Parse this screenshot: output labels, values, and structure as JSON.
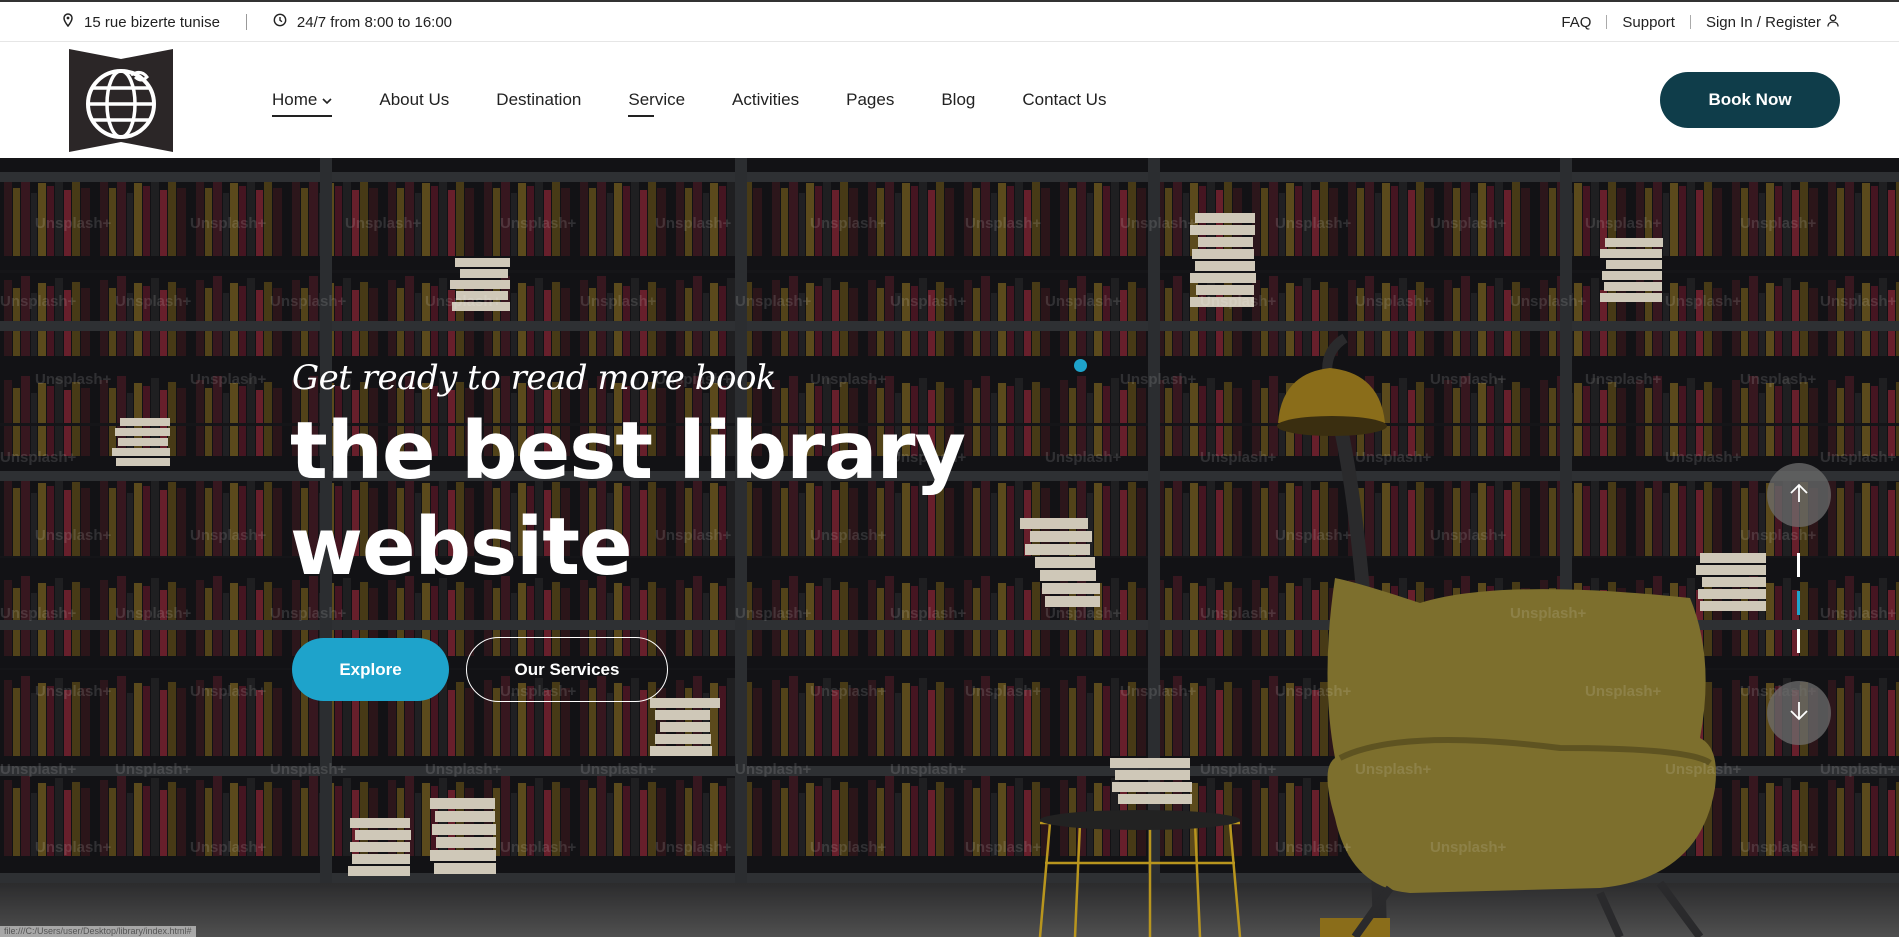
{
  "topbar": {
    "address": "15 rue bizerte tunise",
    "hours": "24/7 from 8:00 to 16:00",
    "faq": "FAQ",
    "support": "Support",
    "signin": "Sign In / Register"
  },
  "nav": {
    "items": [
      {
        "label": "Home",
        "dropdown": true,
        "active": true
      },
      {
        "label": "About Us"
      },
      {
        "label": "Destination"
      },
      {
        "label": "Service",
        "hover": true
      },
      {
        "label": "Activities"
      },
      {
        "label": "Pages"
      },
      {
        "label": "Blog"
      },
      {
        "label": "Contact Us"
      }
    ],
    "book_label": "Book Now"
  },
  "hero": {
    "tagline": "Get ready to read more book",
    "headline_line1": "the best library",
    "headline_line2": "website",
    "explore_label": "Explore",
    "services_label": "Our Services",
    "watermark": "Unsplash+",
    "slides_total": 3,
    "active_slide": 2
  },
  "status_bar": {
    "url": "file:///C:/Users/user/Desktop/library/index.html#"
  },
  "colors": {
    "accent": "#1ea3cb",
    "book_button": "#0f3d4a",
    "shelf_dark": "#1c1d20"
  },
  "icons": {
    "address": "map-pin-icon",
    "hours": "clock-icon",
    "signin": "user-icon",
    "home_dropdown": "chevron-down-icon",
    "slide_up": "arrow-up-icon",
    "slide_down": "arrow-down-icon"
  }
}
